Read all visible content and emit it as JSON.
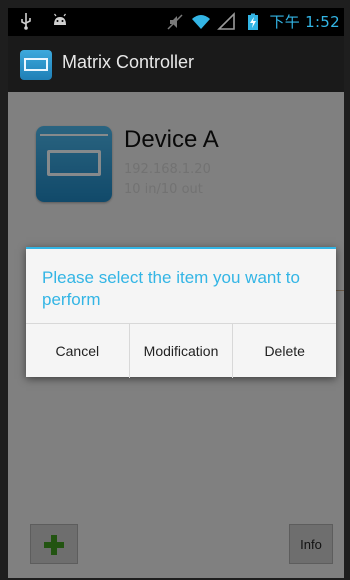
{
  "status_bar": {
    "time": "下午 1:52",
    "icons": [
      "usb-icon",
      "android-icon",
      "mute-icon",
      "wifi-icon",
      "signal-icon",
      "battery-charging-icon"
    ]
  },
  "app": {
    "title": "Matrix Controller",
    "icon": "matrix-app-icon"
  },
  "device": {
    "name": "Device A",
    "ip": "192.168.1.20",
    "ports": "10 in/10 out",
    "icon": "matrix-device-icon"
  },
  "dialog": {
    "title": "Please select the item you want to perform",
    "buttons": {
      "cancel": "Cancel",
      "modify": "Modification",
      "delete": "Delete"
    }
  },
  "toolbar": {
    "info_label": "Info",
    "add_icon": "plus-icon"
  },
  "colors": {
    "accent": "#33b5e5",
    "add_icon": "#3f9a1f"
  }
}
